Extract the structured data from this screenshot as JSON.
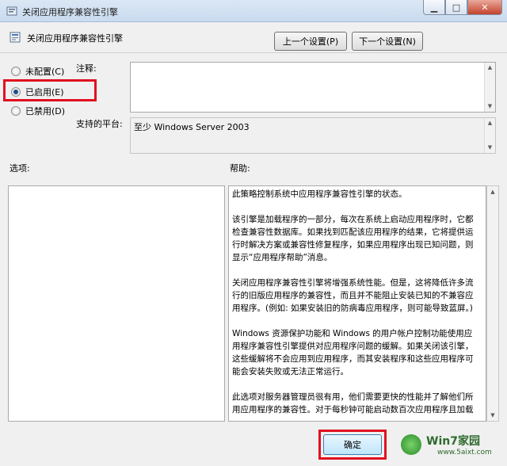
{
  "window": {
    "title": "关闭应用程序兼容性引擎"
  },
  "header": {
    "title": "关闭应用程序兼容性引擎",
    "prev_label": "上一个设置(P)",
    "next_label": "下一个设置(N)"
  },
  "state": {
    "options": [
      {
        "label": "未配置(C)",
        "checked": false
      },
      {
        "label": "已启用(E)",
        "checked": true
      },
      {
        "label": "已禁用(D)",
        "checked": false
      }
    ]
  },
  "comment": {
    "label": "注释:",
    "value": ""
  },
  "platform": {
    "label": "支持的平台:",
    "value": "至少 Windows Server 2003"
  },
  "options_panel": {
    "label": "选项:"
  },
  "help_panel": {
    "label": "帮助:",
    "paragraphs": [
      "此策略控制系统中应用程序兼容性引擎的状态。",
      "该引擎是加载程序的一部分，每次在系统上启动应用程序时，它都检查兼容性数据库。如果找到匹配该应用程序的结果，它将提供运行时解决方案或兼容性修复程序，如果应用程序出现已知问题，则显示“应用程序帮助”消息。",
      "关闭应用程序兼容性引擎将增强系统性能。但是，这将降低许多流行的旧版应用程序的兼容性，而且并不能阻止安装已知的不兼容应用程序。(例如: 如果安装旧的防病毒应用程序，则可能导致蓝屏。)",
      "Windows 资源保护功能和 Windows 的用户帐户控制功能使用应用程序兼容性引擎提供对应用程序问题的缓解。如果关闭该引擎，这些缓解将不会应用到应用程序，而其安装程序和这些应用程序可能会安装失败或无法正常运行。",
      "此选项对服务器管理员很有用，他们需要更快的性能并了解他们所用应用程序的兼容性。对于每秒钟可能启动数百次应用程序且加载"
    ]
  },
  "footer": {
    "ok_label": "确定"
  },
  "watermark": {
    "brand": "Win7家园",
    "url": "www.5aixt.com"
  }
}
